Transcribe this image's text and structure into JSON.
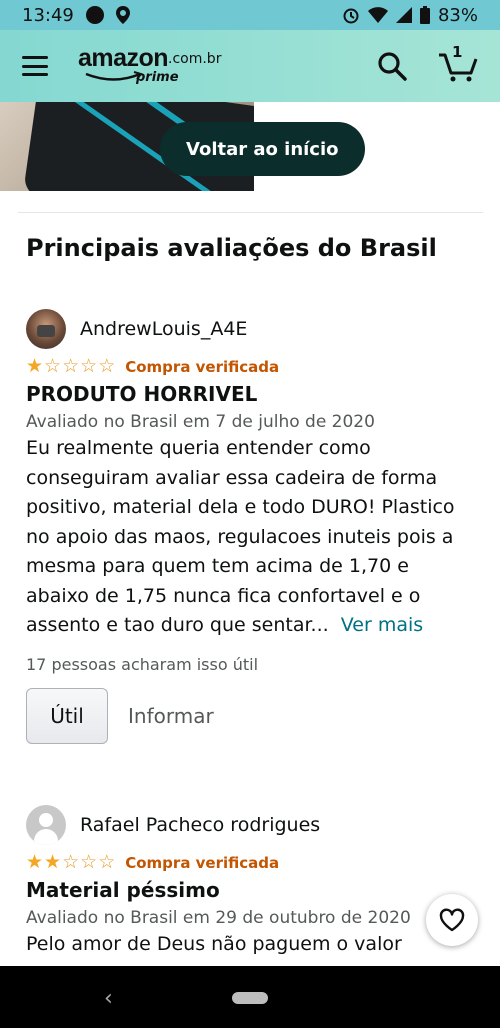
{
  "status_bar": {
    "time": "13:49",
    "battery": "83%"
  },
  "header": {
    "logo_text": "amazon",
    "logo_domain": ".com.br",
    "logo_sub": "prime",
    "cart_count": "1"
  },
  "hero": {
    "back_to_top_label": "Voltar ao início"
  },
  "section_title": "Principais avaliações do Brasil",
  "reviews": [
    {
      "name": "AndrewLouis_A4E",
      "rating": 1,
      "verified_label": "Compra verificada",
      "title": "PRODUTO HORRIVEL",
      "meta": "Avaliado no Brasil em 7 de julho de 2020",
      "body": "Eu realmente queria entender como conseguiram avaliar essa cadeira de forma positivo, material dela e todo DURO! Plastico no apoio das maos, regulacoes inuteis pois a mesma para quem tem acima de 1,70 e abaixo de 1,75 nunca fica confortavel e o assento e tao duro que sentar...",
      "see_more": "Ver mais",
      "helpful": "17 pessoas acharam isso útil",
      "useful_label": "Útil",
      "report_label": "Informar"
    },
    {
      "name": "Rafael Pacheco rodrigues",
      "rating": 2,
      "verified_label": "Compra verificada",
      "title": "Material péssimo",
      "meta": "Avaliado no Brasil em 29 de outubro de 2020",
      "body": "Pelo amor de Deus não paguem o valor"
    }
  ],
  "colors": {
    "header": "#84d8d1",
    "status_bar": "#70c9d2",
    "star": "#f5a623",
    "verified": "#c45500",
    "link": "#007185"
  }
}
